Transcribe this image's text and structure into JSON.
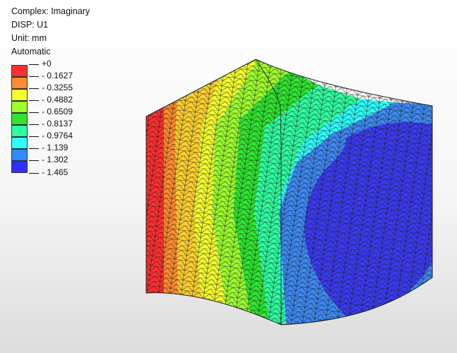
{
  "info": {
    "complex": "Complex: Imaginary",
    "variable": "DISP: U1",
    "unit": "Unit: mm",
    "range_mode": "Automatic"
  },
  "legend": {
    "entries": [
      {
        "label": "+0",
        "color": "#ff2f2f"
      },
      {
        "label": "- 0.1627",
        "color": "#ff8c2f"
      },
      {
        "label": "- 0.3255",
        "color": "#ffd12f"
      },
      {
        "label": "- 0.4882",
        "color": "#f5ff2f"
      },
      {
        "label": "- 0.6509",
        "color": "#9dff2f"
      },
      {
        "label": "- 0.8137",
        "color": "#2fe52f"
      },
      {
        "label": "- 0.9764",
        "color": "#2fffa0"
      },
      {
        "label": "- 1.139",
        "color": "#2fffff"
      },
      {
        "label": "- 1.302",
        "color": "#2f8bff"
      },
      {
        "label": "- 1.465",
        "color": "#2f2fff"
      }
    ]
  },
  "model": {
    "description_colors": {
      "mesh_line": "#1a1a1a",
      "dark_blue": "#3a3aef",
      "mid_blue": "#3d88f0"
    }
  }
}
